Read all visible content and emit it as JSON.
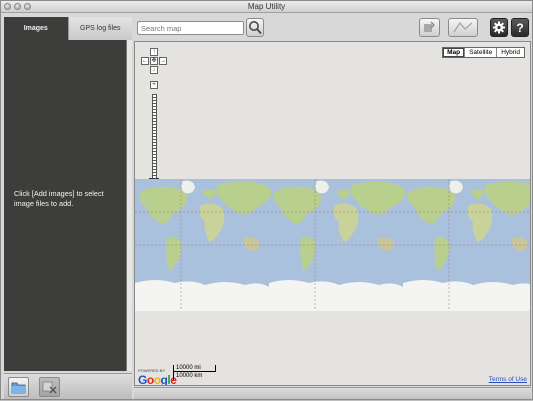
{
  "window": {
    "title": "Map Utility"
  },
  "sidebar": {
    "tabs": [
      {
        "label": "Images"
      },
      {
        "label": "GPS log files"
      }
    ],
    "message": "Click [Add images] to select image files to add."
  },
  "search": {
    "placeholder": "Search map"
  },
  "map": {
    "types": [
      {
        "label": "Map"
      },
      {
        "label": "Satellite"
      },
      {
        "label": "Hybrid"
      }
    ],
    "selected_type": "Map",
    "scale": {
      "miles": "10000 mi",
      "km": "10000 km"
    },
    "powered_by": "POWERED BY",
    "brand": "Google",
    "terms": "Terms of Use"
  },
  "icons": {
    "add-images": "folder-icon",
    "remove-images": "remove-images-icon",
    "search": "magnifier-icon",
    "settings": "gear-icon",
    "help": "question-icon"
  },
  "colors": {
    "sidebar": "#3d3d3b",
    "ocean": "#a9c1dc",
    "land": "#b8cf8e",
    "ice": "#f4f4f2",
    "map_bg": "#e5e3df"
  }
}
